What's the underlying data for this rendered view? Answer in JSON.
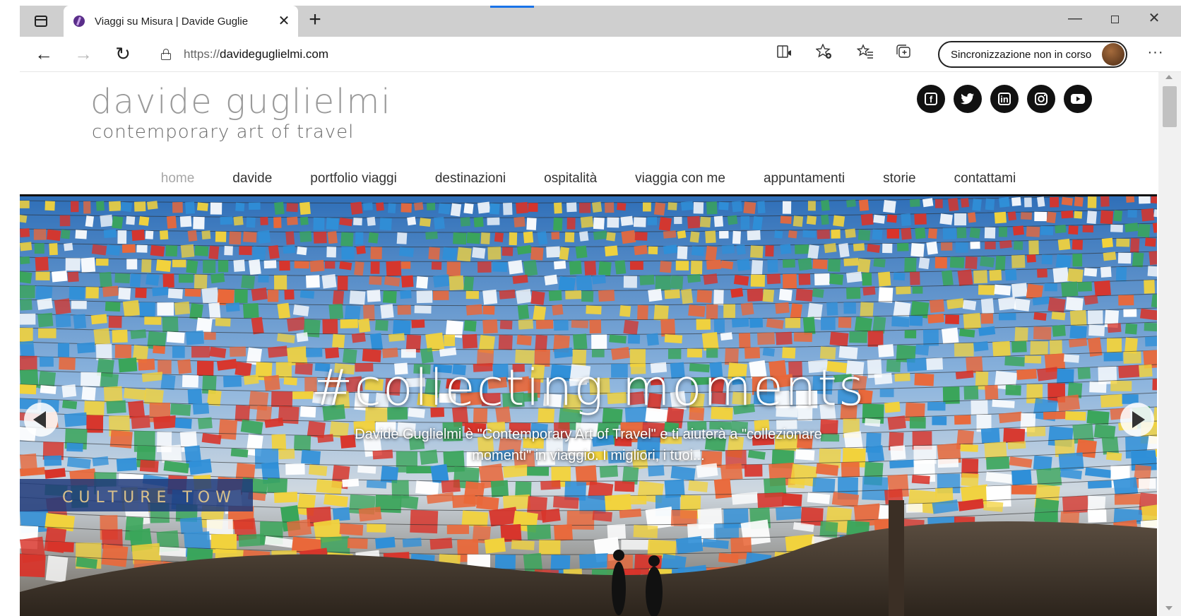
{
  "browser": {
    "tab": {
      "title": "Viaggi su Misura | Davide Guglie",
      "close_glyph": "✕"
    },
    "new_tab_glyph": "+",
    "window_controls": {
      "minimize": "—",
      "close": "✕"
    },
    "nav": {
      "back": "←",
      "forward": "→",
      "reload": "↻"
    },
    "url": {
      "protocol": "https://",
      "host": "davideguglielmi.com"
    },
    "sync_label": "Sincronizzazione non in corso",
    "more_glyph": "···",
    "icons": [
      "tab-actions-icon",
      "reading-view-icon",
      "add-favorite-icon",
      "favorites-icon",
      "collections-icon"
    ]
  },
  "site": {
    "logo": {
      "title": "davide guglielmi",
      "subtitle": "contemporary art of travel"
    },
    "social": [
      {
        "name": "facebook-icon",
        "glyph": "f"
      },
      {
        "name": "twitter-icon",
        "glyph": "t"
      },
      {
        "name": "linkedin-icon",
        "glyph": "in"
      },
      {
        "name": "instagram-icon",
        "glyph": "◎"
      },
      {
        "name": "youtube-icon",
        "glyph": "▶"
      }
    ],
    "nav": {
      "items": [
        {
          "label": "home",
          "active": true
        },
        {
          "label": "davide"
        },
        {
          "label": "portfolio viaggi"
        },
        {
          "label": "destinazioni"
        },
        {
          "label": "ospitalità"
        },
        {
          "label": "viaggia con me"
        },
        {
          "label": "appuntamenti"
        },
        {
          "label": "storie"
        },
        {
          "label": "contattami"
        }
      ]
    },
    "hero": {
      "heading": "#collecting moments",
      "text": "Davide Guglielmi è \"Contemporary Art of Travel\" e ti aiuterà a \"collezionare momenti\" in viaggio. I migliori, i tuoi...",
      "image_sign_text": "CULTURE TOW",
      "flag_colors": [
        "#d8342a",
        "#f2d23c",
        "#2f8fd8",
        "#3aa55a",
        "#ffffff",
        "#e9683a"
      ],
      "sky_color": "#3d7fc8"
    }
  }
}
